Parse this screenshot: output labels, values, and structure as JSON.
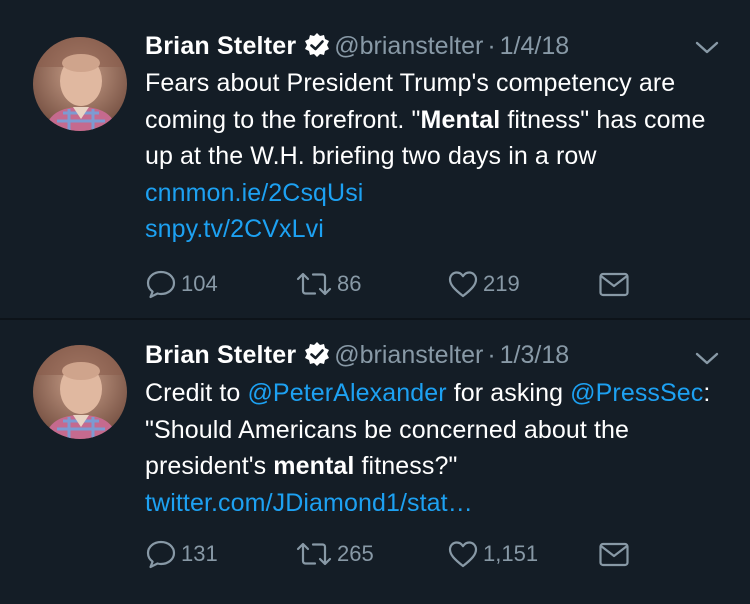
{
  "tweets": [
    {
      "author": "Brian Stelter",
      "handle": "@brianstelter",
      "separator": "·",
      "date": "1/4/18",
      "text_parts": {
        "a": "Fears about President Trump's competency are coming to the forefront. \"",
        "b": "Mental",
        "c": " fitness\" has come up at the W.H. briefing two days in a row ",
        "link1": "cnnmon.ie/2CsqUsi",
        "link2": "snpy.tv/2CVxLvi"
      },
      "replies": "104",
      "retweets": "86",
      "likes": "219"
    },
    {
      "author": "Brian Stelter",
      "handle": "@brianstelter",
      "separator": "·",
      "date": "1/3/18",
      "text_parts": {
        "a": "Credit to ",
        "mention1": "@PeterAlexander",
        "b": " for asking ",
        "mention2": "@PressSec",
        "c": ": \"Should Americans be concerned about the president's ",
        "d": "mental",
        "e": " fitness?\" ",
        "link1": "twitter.com/JDiamond1/stat…"
      },
      "replies": "131",
      "retweets": "265",
      "likes": "1,151"
    }
  ],
  "colors": {
    "background": "#141d26",
    "text": "#ffffff",
    "secondary": "#8899a6",
    "link": "#1da1f2",
    "verified": "#ffffff"
  },
  "icons": {
    "reply": "reply-icon",
    "retweet": "retweet-icon",
    "like": "heart-icon",
    "message": "envelope-icon",
    "verified": "verified-badge-icon",
    "menu": "chevron-down-icon"
  }
}
